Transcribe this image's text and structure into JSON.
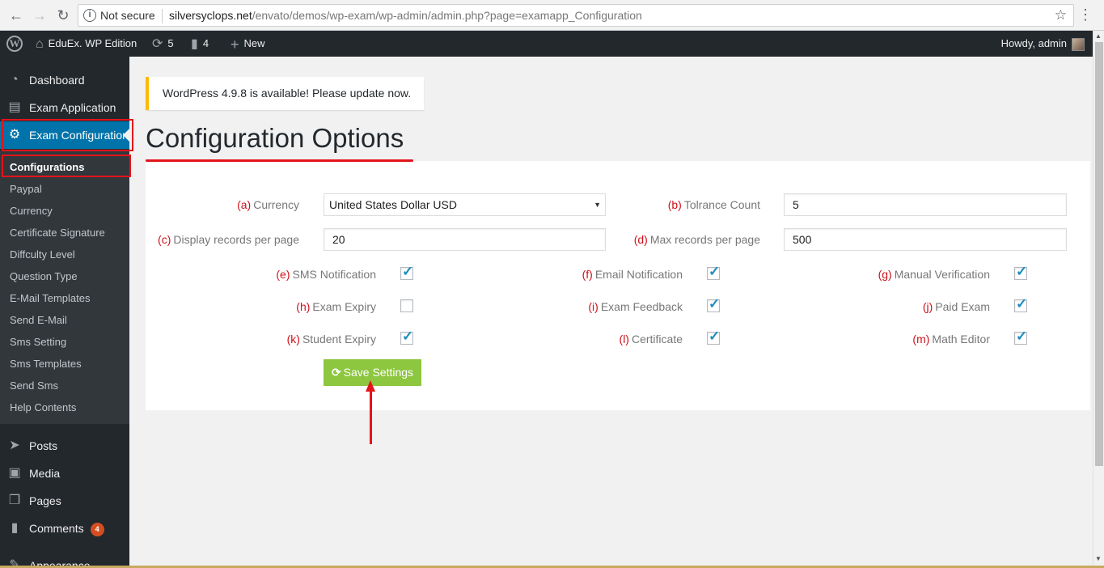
{
  "browser": {
    "security_label": "Not secure",
    "url_domain": "silversyclops.net",
    "url_path": "/envato/demos/wp-exam/wp-admin/admin.php?page=examapp_Configuration"
  },
  "adminbar": {
    "site_name": "EduEx. WP Edition",
    "updates_count": "5",
    "comments_count": "4",
    "new_label": "New",
    "howdy": "Howdy, admin"
  },
  "sidebar": {
    "items_top": [
      {
        "label": "Dashboard",
        "icon": "dashboard-icon"
      },
      {
        "label": "Exam Application",
        "icon": "exam-application-icon"
      },
      {
        "label": "Exam Configuration",
        "icon": "gear-icon"
      }
    ],
    "submenu": [
      "Configurations",
      "Paypal",
      "Currency",
      "Certificate Signature",
      "Diffculty Level",
      "Question Type",
      "E-Mail Templates",
      "Send E-Mail",
      "Sms Setting",
      "Sms Templates",
      "Send Sms",
      "Help Contents"
    ],
    "items_bottom": [
      {
        "label": "Posts",
        "icon": "pin-icon"
      },
      {
        "label": "Media",
        "icon": "media-icon"
      },
      {
        "label": "Pages",
        "icon": "pages-icon"
      },
      {
        "label": "Comments",
        "icon": "comment-icon",
        "badge": "4"
      },
      {
        "label": "Appearance",
        "icon": "brush-icon"
      }
    ]
  },
  "notice": "WordPress 4.9.8 is available! Please update now.",
  "page_title": "Configuration Options",
  "form": {
    "currency": {
      "tag": "(a)",
      "label": "Currency",
      "value": "United States Dollar USD"
    },
    "tolrance": {
      "tag": "(b)",
      "label": "Tolrance Count",
      "value": "5"
    },
    "display_records": {
      "tag": "(c)",
      "label": "Display records per page",
      "value": "20"
    },
    "max_records": {
      "tag": "(d)",
      "label": "Max records per page",
      "value": "500"
    },
    "sms_notification": {
      "tag": "(e)",
      "label": "SMS Notification",
      "checked": true
    },
    "email_notification": {
      "tag": "(f)",
      "label": "Email Notification",
      "checked": true
    },
    "manual_verification": {
      "tag": "(g)",
      "label": "Manual Verification",
      "checked": true
    },
    "exam_expiry": {
      "tag": "(h)",
      "label": "Exam Expiry",
      "checked": false
    },
    "exam_feedback": {
      "tag": "(i)",
      "label": "Exam Feedback",
      "checked": true
    },
    "paid_exam": {
      "tag": "(j)",
      "label": "Paid Exam",
      "checked": true
    },
    "student_expiry": {
      "tag": "(k)",
      "label": "Student Expiry",
      "checked": true
    },
    "certificate": {
      "tag": "(l)",
      "label": "Certificate",
      "checked": true
    },
    "math_editor": {
      "tag": "(m)",
      "label": "Math Editor",
      "checked": true
    },
    "save_label": "Save Settings"
  },
  "colors": {
    "accent": "#0073aa",
    "save_button": "#8dc63f",
    "annotation_red": "#e3141b",
    "notice_border": "#ffb900"
  }
}
